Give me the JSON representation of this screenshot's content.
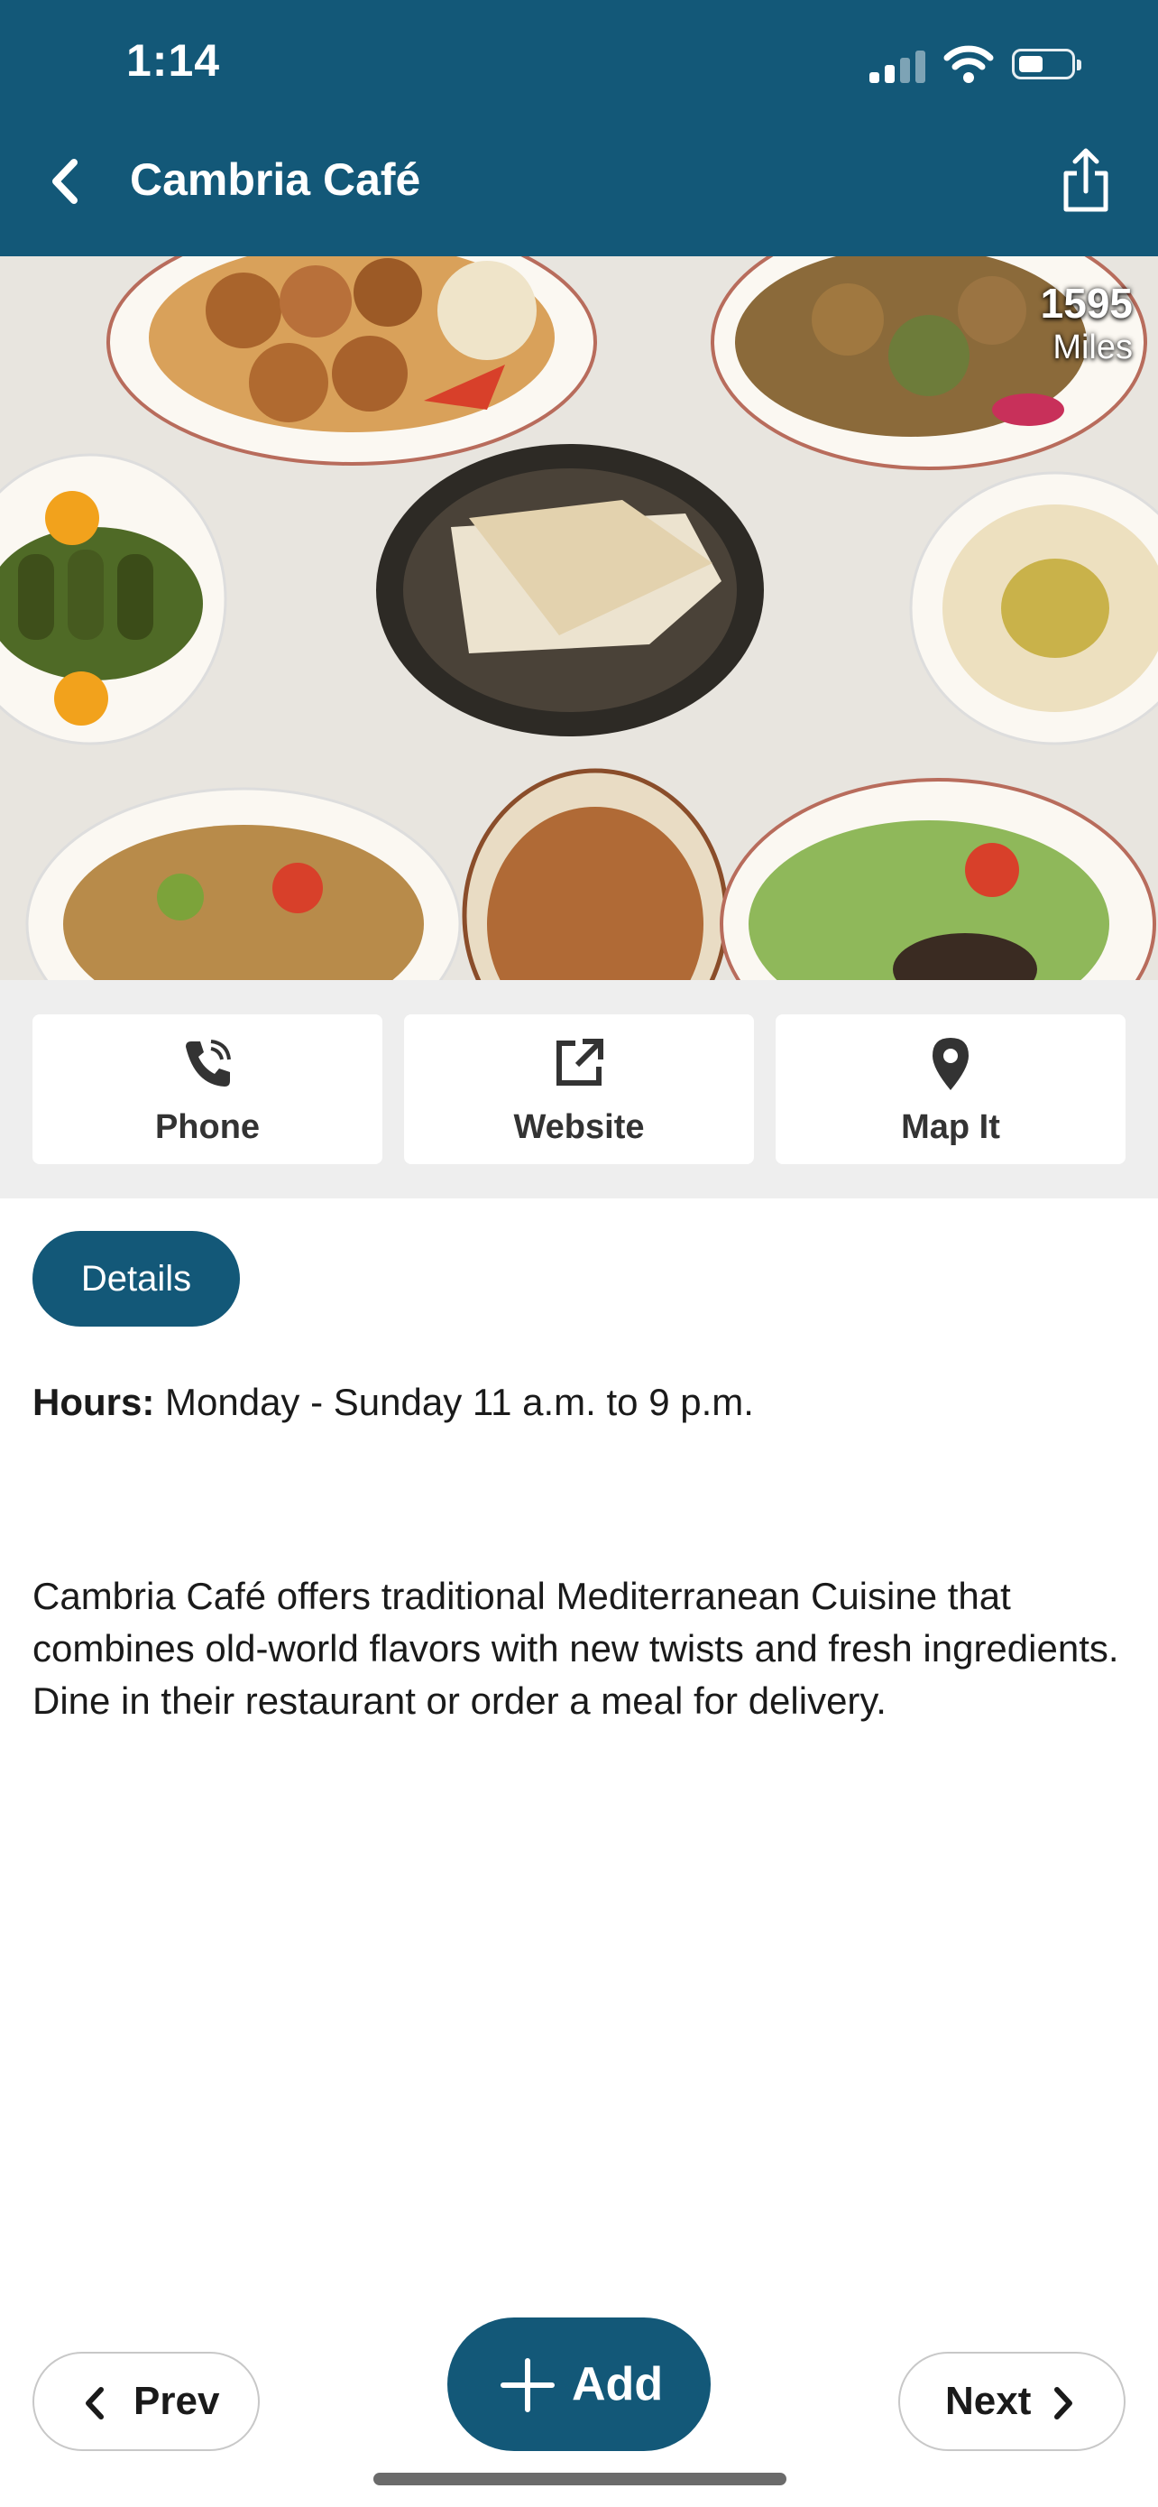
{
  "status_bar": {
    "time": "1:14"
  },
  "header": {
    "title": "Cambria Café"
  },
  "hero": {
    "distance_value": "1595",
    "distance_unit": "Miles"
  },
  "actions": [
    {
      "label": "Phone",
      "icon": "phone-icon"
    },
    {
      "label": "Website",
      "icon": "external-link-icon"
    },
    {
      "label": "Map It",
      "icon": "map-pin-icon"
    }
  ],
  "details": {
    "tab_label": "Details",
    "hours_label": "Hours:",
    "hours_value": " Monday - Sunday 11 a.m. to 9 p.m.",
    "description": "Cambria Café offers traditional Mediterranean Cuisine that combines old-world flavors with new twists and fresh ingredients. Dine in their restaurant or order a meal for delivery."
  },
  "bottom_bar": {
    "prev_label": "Prev",
    "add_label": "Add",
    "next_label": "Next"
  },
  "colors": {
    "brand": "#135878",
    "button_bg": "#ffffff",
    "actions_bg": "#eeeeee"
  }
}
